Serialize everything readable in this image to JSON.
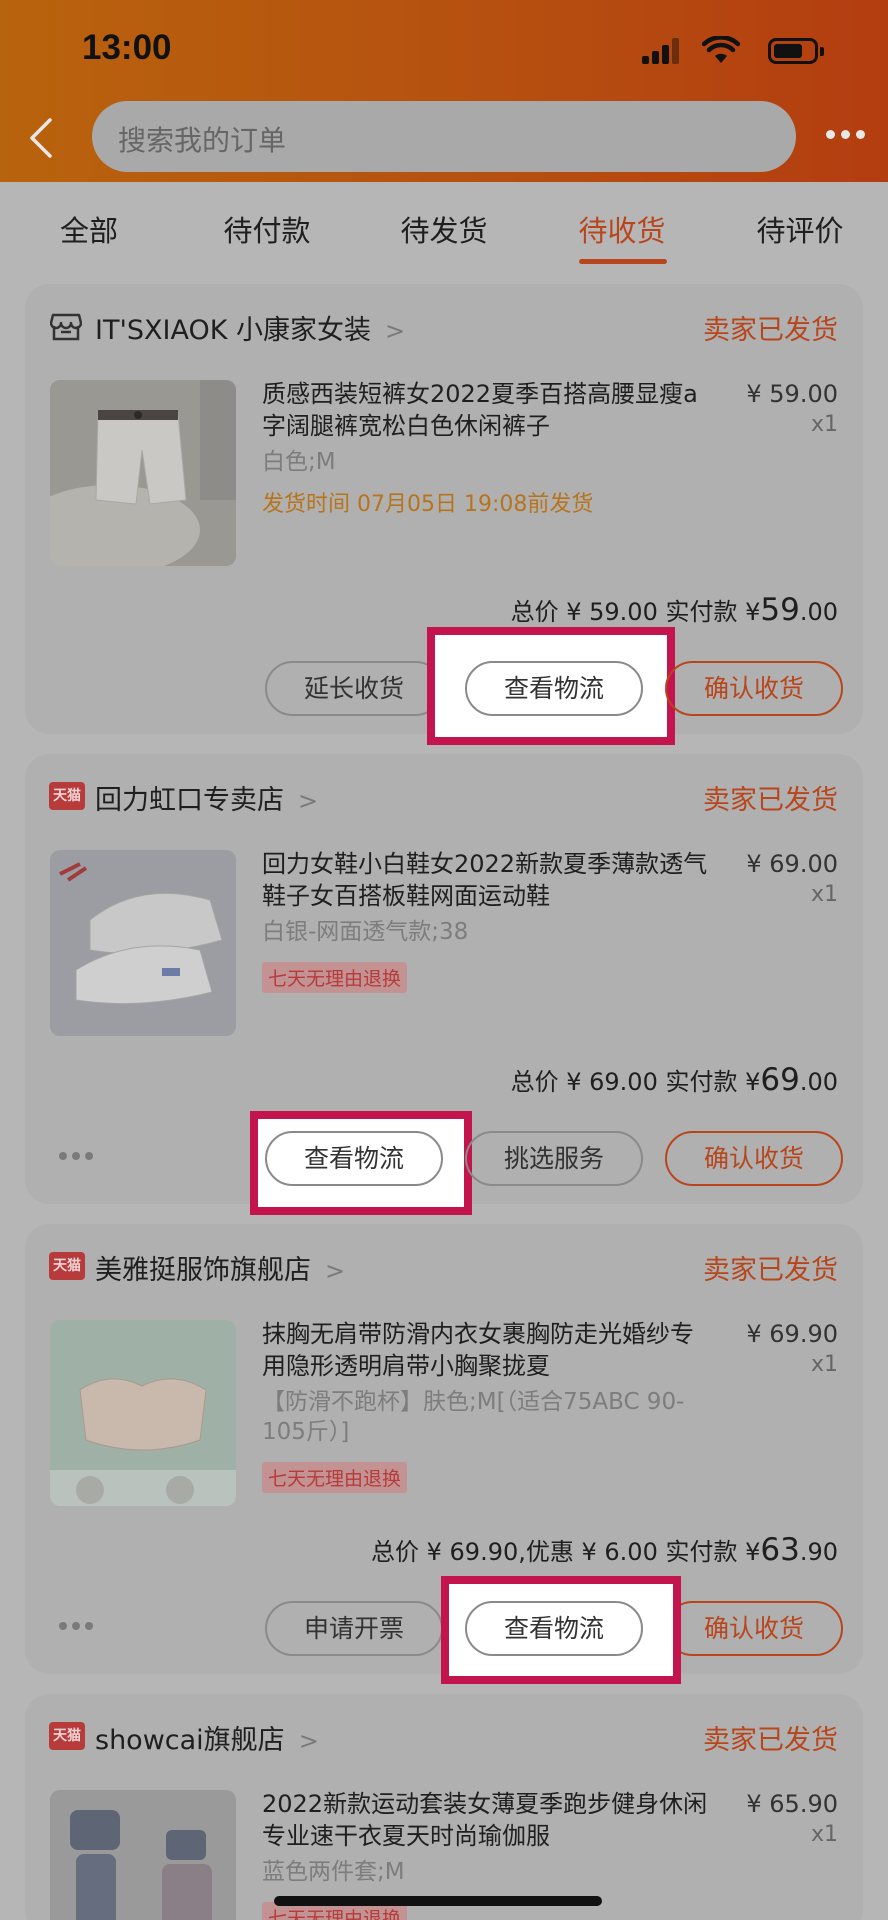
{
  "status_bar": {
    "time": "13:00"
  },
  "search": {
    "placeholder": "搜索我的订单"
  },
  "tabs": [
    {
      "label": "全部"
    },
    {
      "label": "待付款"
    },
    {
      "label": "待发货"
    },
    {
      "label": "待收货",
      "active": true
    },
    {
      "label": "待评价"
    }
  ],
  "orders": [
    {
      "shop": "IT'SXIAOK 小康家女装",
      "shop_badge": "",
      "status": "卖家已发货",
      "title": "质感西装短裤女2022夏季百搭高腰显瘦a字阔腿裤宽松白色休闲裤子",
      "price": "¥ 59.00",
      "qty": "x1",
      "spec": "白色;M",
      "note": "发货时间 07月05日 19:08前发货",
      "total_prefix": "总价 ¥ 59.00 实付款 ¥",
      "total_big": "59",
      "total_cents": ".00",
      "buttons": [
        "延长收货",
        "查看物流",
        "确认收货"
      ]
    },
    {
      "shop": "回力虹口专卖店",
      "shop_badge": "天猫",
      "status": "卖家已发货",
      "title": "回力女鞋小白鞋女2022新款夏季薄款透气鞋子女百搭板鞋网面运动鞋",
      "price": "¥ 69.00",
      "qty": "x1",
      "spec": "白银-网面透气款;38",
      "tag": "七天无理由退换",
      "total_prefix": "总价 ¥ 69.00 实付款 ¥",
      "total_big": "69",
      "total_cents": ".00",
      "buttons": [
        "查看物流",
        "挑选服务",
        "确认收货"
      ]
    },
    {
      "shop": "美雅挺服饰旗舰店",
      "shop_badge": "天猫",
      "status": "卖家已发货",
      "title": "抹胸无肩带防滑内衣女裹胸防走光婚纱专用隐形透明肩带小胸聚拢夏",
      "price": "¥ 69.90",
      "qty": "x1",
      "spec": "【防滑不跑杯】肤色;M[（适合75ABC 90-105斤）]",
      "tag": "七天无理由退换",
      "total_prefix": "总价 ¥ 69.90,优惠 ¥ 6.00 实付款 ¥",
      "total_big": "63",
      "total_cents": ".90",
      "buttons": [
        "申请开票",
        "查看物流",
        "确认收货"
      ]
    },
    {
      "shop": "showcai旗舰店",
      "shop_badge": "天猫",
      "status": "卖家已发货",
      "title": "2022新款运动套装女薄夏季跑步健身休闲专业速干衣夏天时尚瑜伽服",
      "price": "¥ 65.90",
      "qty": "x1",
      "spec": "蓝色两件套;M",
      "tag": "七天无理由退换"
    }
  ],
  "colors": {
    "accent": "#b8461c",
    "highlight_border": "#c4144d"
  }
}
